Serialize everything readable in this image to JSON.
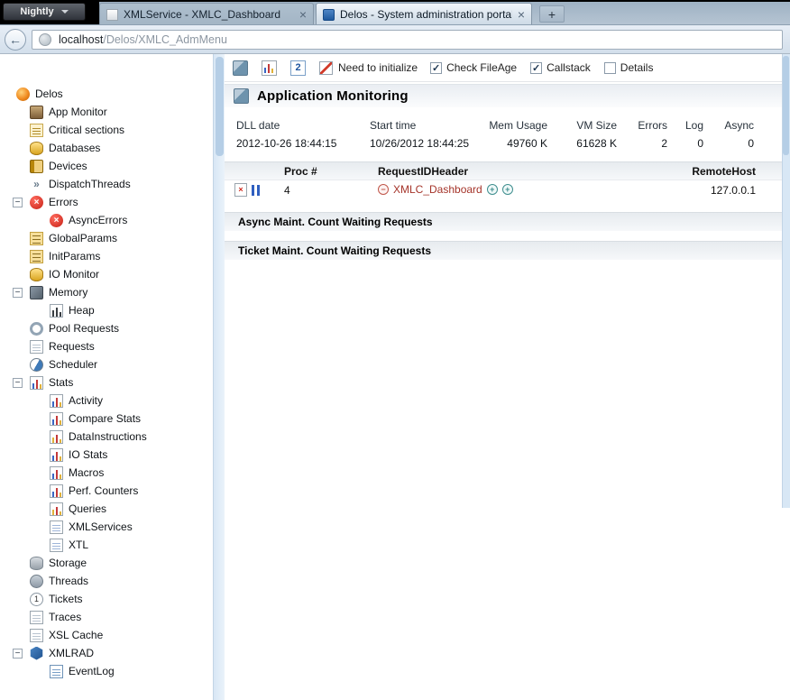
{
  "browser": {
    "app_button_label": "Nightly",
    "tabs": [
      {
        "title": "XMLService - XMLC_Dashboard"
      },
      {
        "title": "Delos - System administration portal"
      }
    ],
    "url": {
      "host": "localhost",
      "path": "/Delos/XMLC_AdmMenu"
    }
  },
  "sidebar": {
    "items": [
      {
        "label": "Delos",
        "level": 0,
        "expanded": false,
        "icon": "delos-icon"
      },
      {
        "label": "App Monitor",
        "level": 1,
        "expanded": false,
        "icon": "app-monitor-icon"
      },
      {
        "label": "Critical sections",
        "level": 1,
        "expanded": false,
        "icon": "critical-sections-icon"
      },
      {
        "label": "Databases",
        "level": 1,
        "expanded": false,
        "icon": "databases-icon"
      },
      {
        "label": "Devices",
        "level": 1,
        "expanded": false,
        "icon": "devices-icon"
      },
      {
        "label": "DispatchThreads",
        "level": 1,
        "expanded": false,
        "icon": "dispatch-threads-icon"
      },
      {
        "label": "Errors",
        "level": 1,
        "expanded": true,
        "icon": "errors-icon"
      },
      {
        "label": "AsyncErrors",
        "level": 2,
        "expanded": false,
        "icon": "async-errors-icon"
      },
      {
        "label": "GlobalParams",
        "level": 1,
        "expanded": false,
        "icon": "global-params-icon"
      },
      {
        "label": "InitParams",
        "level": 1,
        "expanded": false,
        "icon": "init-params-icon"
      },
      {
        "label": "IO Monitor",
        "level": 1,
        "expanded": false,
        "icon": "io-monitor-icon"
      },
      {
        "label": "Memory",
        "level": 1,
        "expanded": true,
        "icon": "memory-icon"
      },
      {
        "label": "Heap",
        "level": 2,
        "expanded": false,
        "icon": "heap-icon"
      },
      {
        "label": "Pool Requests",
        "level": 1,
        "expanded": false,
        "icon": "pool-requests-icon"
      },
      {
        "label": "Requests",
        "level": 1,
        "expanded": false,
        "icon": "requests-icon"
      },
      {
        "label": "Scheduler",
        "level": 1,
        "expanded": false,
        "icon": "scheduler-icon"
      },
      {
        "label": "Stats",
        "level": 1,
        "expanded": true,
        "icon": "stats-icon"
      },
      {
        "label": "Activity",
        "level": 2,
        "expanded": false,
        "icon": "activity-icon"
      },
      {
        "label": "Compare Stats",
        "level": 2,
        "expanded": false,
        "icon": "compare-stats-icon"
      },
      {
        "label": "DataInstructions",
        "level": 2,
        "expanded": false,
        "icon": "data-instructions-icon"
      },
      {
        "label": "IO Stats",
        "level": 2,
        "expanded": false,
        "icon": "io-stats-icon"
      },
      {
        "label": "Macros",
        "level": 2,
        "expanded": false,
        "icon": "macros-icon"
      },
      {
        "label": "Perf. Counters",
        "level": 2,
        "expanded": false,
        "icon": "perf-counters-icon"
      },
      {
        "label": "Queries",
        "level": 2,
        "expanded": false,
        "icon": "queries-icon"
      },
      {
        "label": "XMLServices",
        "level": 2,
        "expanded": false,
        "icon": "xml-services-icon"
      },
      {
        "label": "XTL",
        "level": 2,
        "expanded": false,
        "icon": "xtl-icon"
      },
      {
        "label": "Storage",
        "level": 1,
        "expanded": false,
        "icon": "storage-icon"
      },
      {
        "label": "Threads",
        "level": 1,
        "expanded": false,
        "icon": "threads-icon"
      },
      {
        "label": "Tickets",
        "level": 1,
        "expanded": false,
        "icon": "tickets-icon"
      },
      {
        "label": "Traces",
        "level": 1,
        "expanded": false,
        "icon": "traces-icon"
      },
      {
        "label": "XSL Cache",
        "level": 1,
        "expanded": false,
        "icon": "xsl-cache-icon"
      },
      {
        "label": "XMLRAD",
        "level": 1,
        "expanded": true,
        "icon": "xmlrad-icon"
      },
      {
        "label": "EventLog",
        "level": 2,
        "expanded": false,
        "icon": "event-log-icon"
      }
    ]
  },
  "toolbar": {
    "refresh_interval_label": "2",
    "init_label": "Need to initialize",
    "checkboxes": [
      {
        "label": "Check FileAge",
        "checked": true
      },
      {
        "label": "Callstack",
        "checked": true
      },
      {
        "label": "Details",
        "checked": false
      }
    ]
  },
  "main": {
    "title": "Application Monitoring",
    "stats": {
      "headers": [
        "DLL date",
        "Start time",
        "Mem Usage",
        "VM Size",
        "Errors",
        "Log",
        "Async"
      ],
      "values": [
        "2012-10-26 18:44:15",
        "10/26/2012 18:44:25",
        "49760 K",
        "61628 K",
        "2",
        "0",
        "0"
      ]
    },
    "requests_table": {
      "proc_header": "Proc #",
      "request_header": "RequestIDHeader",
      "remote_header": "RemoteHost",
      "row": {
        "proc": "4",
        "request_id": "XMLC_Dashboard",
        "remote_host": "127.0.0.1"
      }
    },
    "sections": [
      {
        "title": "Async Maint. Count Waiting Requests"
      },
      {
        "title": "Ticket Maint. Count Waiting Requests"
      }
    ]
  }
}
